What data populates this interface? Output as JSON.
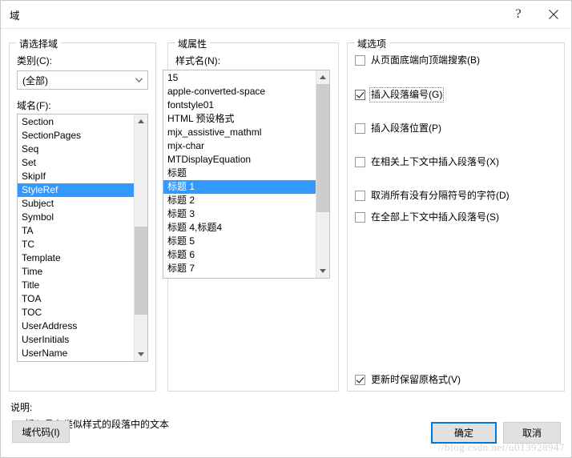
{
  "window": {
    "title": "域",
    "help_icon": "question-mark-icon",
    "close_icon": "close-icon"
  },
  "left_group": {
    "legend": "请选择域",
    "category_label": "类别(C):",
    "category_value": "(全部)",
    "fieldname_label": "域名(F):",
    "field_items": [
      "Section",
      "SectionPages",
      "Seq",
      "Set",
      "SkipIf",
      "StyleRef",
      "Subject",
      "Symbol",
      "TA",
      "TC",
      "Template",
      "Time",
      "Title",
      "TOA",
      "TOC",
      "UserAddress",
      "UserInitials",
      "UserName"
    ],
    "selected_field": "StyleRef"
  },
  "middle_group": {
    "legend": "域属性",
    "stylename_label": "样式名(N):",
    "style_items": [
      "15",
      "apple-converted-space",
      "fontstyle01",
      "HTML 预设格式",
      "mjx_assistive_mathml",
      "mjx-char",
      "MTDisplayEquation",
      "标题",
      "标题 1",
      "标题 2",
      "标题 3",
      "标题 4,标题4",
      "标题 5",
      "标题 6",
      "标题 7"
    ],
    "selected_style": "标题 1"
  },
  "right_group": {
    "legend": "域选项",
    "options": [
      {
        "label": "从页面底端向顶端搜索(B)",
        "checked": false,
        "focused": false
      },
      {
        "label": "插入段落编号(G)",
        "checked": true,
        "focused": true
      },
      {
        "label": "插入段落位置(P)",
        "checked": false,
        "focused": false
      },
      {
        "label": "在相关上下文中插入段落号(X)",
        "checked": false,
        "focused": false
      },
      {
        "label": "取消所有没有分隔符号的字符(D)",
        "checked": false,
        "focused": false
      },
      {
        "label": "在全部上下文中插入段落号(S)",
        "checked": false,
        "focused": false
      }
    ],
    "preserve_format": {
      "label": "更新时保留原格式(V)",
      "checked": true
    }
  },
  "description": {
    "label": "说明:",
    "text": "插入具有类似样式的段落中的文本"
  },
  "footer": {
    "field_code_button": "域代码(I)",
    "ok_button": "确定",
    "cancel_button": "取消"
  },
  "watermark": "//blog.csdn.net/u013928947"
}
